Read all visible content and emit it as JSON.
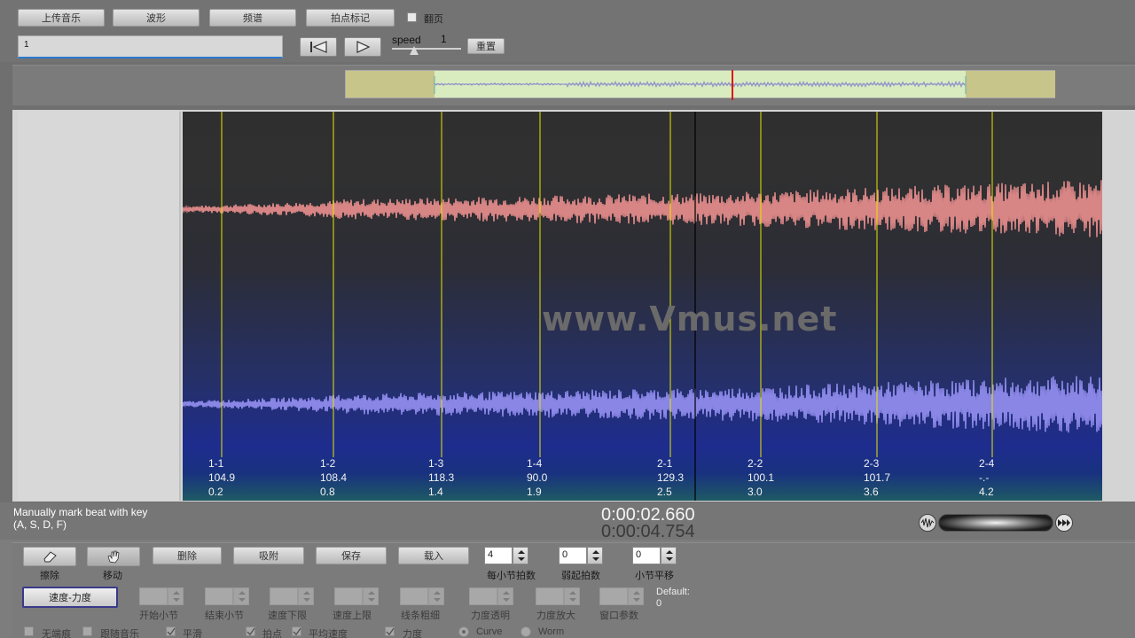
{
  "toolbar": {
    "upload": "上传音乐",
    "waveform": "波形",
    "spectrum": "频谱",
    "beat_mark": "拍点标记",
    "page_turn": "翻页",
    "input_value": "1",
    "speed_label": "speed",
    "speed_value": "1",
    "reset": "重置"
  },
  "watermark": "www.Vmus.net",
  "beats": [
    {
      "id": "1-1",
      "tempo": "104.9",
      "time": "0.2"
    },
    {
      "id": "1-2",
      "tempo": "108.4",
      "time": "0.8"
    },
    {
      "id": "1-3",
      "tempo": "118.3",
      "time": "1.4"
    },
    {
      "id": "1-4",
      "tempo": "90.0",
      "time": "1.9"
    },
    {
      "id": "2-1",
      "tempo": "129.3",
      "time": "2.5"
    },
    {
      "id": "2-2",
      "tempo": "100.1",
      "time": "3.0"
    },
    {
      "id": "2-3",
      "tempo": "101.7",
      "time": "3.6"
    },
    {
      "id": "2-4",
      "tempo": "-.-",
      "time": "4.2"
    }
  ],
  "status": {
    "hint_line1": "Manually mark beat with key",
    "hint_line2": "(A, S, D, F)",
    "time_current": "0:00:02.660",
    "time_total": "0:00:04.754"
  },
  "bottom": {
    "erase": "擦除",
    "move": "移动",
    "delete": "删除",
    "snap": "吸附",
    "save": "保存",
    "load": "载入",
    "beats_per_bar_label": "每小节拍数",
    "beats_per_bar_value": "4",
    "pickup_label": "弱起拍数",
    "pickup_value": "0",
    "bar_shift_label": "小节平移",
    "bar_shift_value": "0",
    "tempo_dynamics": "速度-力度",
    "start_bar": "开始小节",
    "end_bar": "结束小节",
    "tempo_lower": "速度下限",
    "tempo_upper": "速度上限",
    "line_thickness": "线条粗细",
    "dynamics_transparency": "力度透明",
    "dynamics_zoom": "力度放大",
    "window_param": "窗口参数",
    "default_label": "Default:",
    "default_value": "0",
    "no_markers": "无端痕",
    "follow_music": "跟随音乐",
    "smooth": "平滑",
    "beat_points": "拍点",
    "avg_tempo": "平均速度",
    "dynamics": "力度",
    "curve": "Curve",
    "worm": "Worm"
  }
}
